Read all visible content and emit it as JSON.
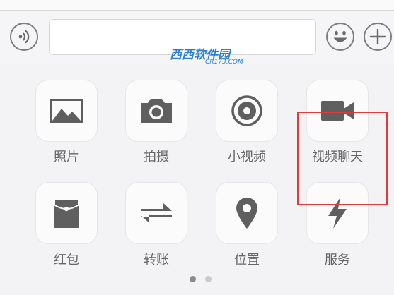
{
  "composer": {
    "input_value": "",
    "voice_icon": "voice-icon",
    "emoji_icon": "emoji-icon",
    "plus_icon": "plus-icon"
  },
  "panel": {
    "items": [
      {
        "label": "照片",
        "icon": "photo-icon"
      },
      {
        "label": "拍摄",
        "icon": "camera-icon"
      },
      {
        "label": "小视频",
        "icon": "sight-video-icon"
      },
      {
        "label": "视频聊天",
        "icon": "video-call-icon"
      },
      {
        "label": "红包",
        "icon": "red-packet-icon"
      },
      {
        "label": "转账",
        "icon": "transfer-icon"
      },
      {
        "label": "位置",
        "icon": "location-icon"
      },
      {
        "label": "服务",
        "icon": "lightning-icon"
      }
    ],
    "page_count": 2,
    "current_page": 1
  },
  "watermark": {
    "text": "西西软件园",
    "subtext": "CR173.COM"
  },
  "colors": {
    "icon": "#5f5f5f",
    "highlight": "#e03a3a",
    "dot_active": "#8a8a8a",
    "dot_inactive": "#c9c9c9"
  }
}
